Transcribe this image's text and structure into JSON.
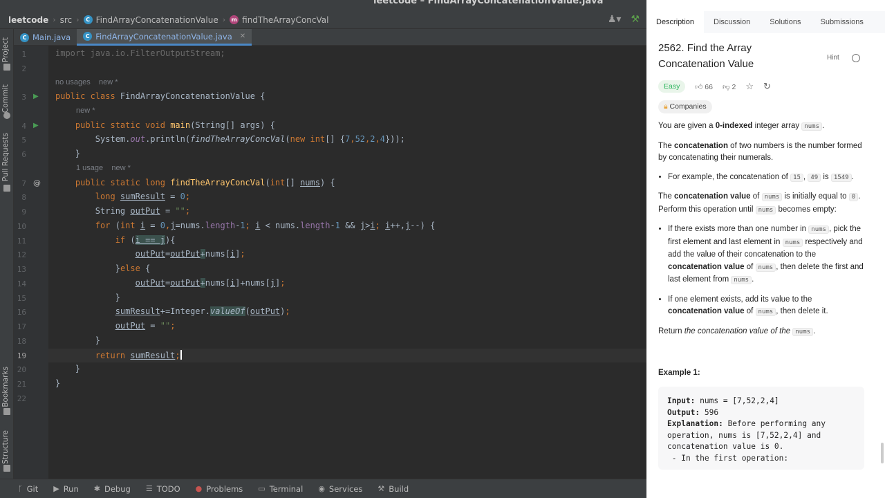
{
  "window_title": "leetcode – FindArrayConcatenationValue.java",
  "breadcrumb": {
    "project": "leetcode",
    "folder": "src",
    "class": "FindArrayConcatenationValue",
    "method": "findTheArrayConcVal"
  },
  "tabs": [
    {
      "label": "Main.java",
      "active": false
    },
    {
      "label": "FindArrayConcatenationValue.java",
      "active": true
    }
  ],
  "left_tool_windows": [
    "Project",
    "Commit",
    "Pull Requests",
    "Bookmarks",
    "Structure"
  ],
  "hints": {
    "no_usages": "no usages",
    "new": "new *",
    "one_usage": "1 usage"
  },
  "code": {
    "l1": "import java.io.FilterOutputStream;",
    "l3_a": "public class ",
    "l3_b": "FindArrayConcatenationValue {",
    "l4_a": "public static void ",
    "l4_b": "main",
    "l4_c": "(String[] args) {",
    "l5_a": "System.",
    "l5_b": "out",
    "l5_c": ".println(",
    "l5_d": "findTheArrayConcVal",
    "l5_e": "(",
    "l5_f": "new int",
    "l5_g": "[] {",
    "l5_h": "7",
    "l5_i": ",",
    "l5_j": "52",
    "l5_k": ",",
    "l5_l": "2",
    "l5_m": ",",
    "l5_n": "4",
    "l5_o": "}));",
    "l6": "}",
    "l7_a": "public static long ",
    "l7_b": "findTheArrayConcVal",
    "l7_c": "(",
    "l7_d": "int",
    "l7_e": "[] ",
    "l7_f": "nums",
    "l7_g": ") {",
    "l8_a": "long ",
    "l8_b": "sumResult",
    "l8_c": " = ",
    "l8_d": "0",
    "l8_e": ";",
    "l9_a": "String ",
    "l9_b": "outPut",
    "l9_c": " = ",
    "l9_d": "\"\"",
    "l9_e": ";",
    "l10_a": "for ",
    "l10_b": "(",
    "l10_c": "int ",
    "l10_d": "i",
    "l10_e": " = ",
    "l10_f": "0",
    "l10_g": ",",
    "l10_h": "j",
    "l10_i": "=nums.",
    "l10_j": "length",
    "l10_k": "-",
    "l10_l": "1",
    "l10_m": "; ",
    "l10_n": "i",
    "l10_o": " < nums.",
    "l10_p": "length",
    "l10_q": "-",
    "l10_r": "1",
    "l10_s": " && ",
    "l10_t": "j",
    "l10_u": ">",
    "l10_v": "i",
    "l10_w": "; ",
    "l10_x": "i",
    "l10_y": "++,",
    "l10_z": "j",
    "l10_zz": "--) {",
    "l11_a": "if ",
    "l11_b": "(",
    "l11_c": "i == j",
    "l11_d": "){",
    "l12_a": "outPut",
    "l12_b": "=",
    "l12_c": "outPut",
    "l12_d": "+",
    "l12_e": "nums[",
    "l12_f": "i",
    "l12_g": "]",
    "l12_h": ";",
    "l13_a": "}",
    "l13_b": "else ",
    "l13_c": "{",
    "l14_a": "outPut",
    "l14_b": "=",
    "l14_c": "outPut",
    "l14_d": "+",
    "l14_e": "nums[",
    "l14_f": "i",
    "l14_g": "]+nums[",
    "l14_h": "j",
    "l14_i": "]",
    "l14_j": ";",
    "l15": "}",
    "l16_a": "sumResult",
    "l16_b": "+=Integer.",
    "l16_c": "valueOf",
    "l16_d": "(",
    "l16_e": "outPut",
    "l16_f": ")",
    "l16_g": ";",
    "l17_a": "outPut",
    "l17_b": " = ",
    "l17_c": "\"\"",
    "l17_d": ";",
    "l18": "}",
    "l19_a": "return ",
    "l19_b": "sumResult",
    "l19_c": ";",
    "l20": "}",
    "l21": "}"
  },
  "line_numbers": [
    "1",
    "2",
    "3",
    "4",
    "5",
    "6",
    "7",
    "8",
    "9",
    "10",
    "11",
    "12",
    "13",
    "14",
    "15",
    "16",
    "17",
    "18",
    "19",
    "20",
    "21",
    "22"
  ],
  "current_line": 19,
  "status_bar": {
    "git": "Git",
    "run": "Run",
    "debug": "Debug",
    "todo": "TODO",
    "problems": "Problems",
    "terminal": "Terminal",
    "services": "Services",
    "build": "Build"
  },
  "leetcode": {
    "tabs": [
      "Description",
      "Discussion",
      "Solutions",
      "Submissions"
    ],
    "active_tab": "Description",
    "title": "2562. Find the Array Concatenation Value",
    "hint": "Hint",
    "difficulty": "Easy",
    "likes": "66",
    "dislikes": "2",
    "companies": "Companies",
    "p1_a": "You are given a ",
    "p1_b": "0-indexed",
    "p1_c": " integer array ",
    "p1_d": "nums",
    "p1_e": ".",
    "p2_a": "The ",
    "p2_b": "concatenation",
    "p2_c": " of two numbers is the number formed by concatenating their numerals.",
    "b1_a": "For example, the concatenation of ",
    "b1_b": "15",
    "b1_c": ", ",
    "b1_d": "49",
    "b1_e": " is ",
    "b1_f": "1549",
    "b1_g": ".",
    "p3_a": "The ",
    "p3_b": "concatenation value",
    "p3_c": " of ",
    "p3_d": "nums",
    "p3_e": " is initially equal to ",
    "p3_f": "0",
    "p3_g": ". Perform this operation until ",
    "p3_h": "nums",
    "p3_i": " becomes empty:",
    "b2_a": "If there exists more than one number in ",
    "b2_b": "nums",
    "b2_c": ", pick the first element and last element in ",
    "b2_d": "nums",
    "b2_e": " respectively and add the value of their concatenation to the ",
    "b2_f": "concatenation value",
    "b2_g": " of ",
    "b2_h": "nums",
    "b2_i": ", then delete the first and last element from ",
    "b2_j": "nums",
    "b2_k": ".",
    "b3_a": "If one element exists, add its value to the ",
    "b3_b": "concatenation value",
    "b3_c": " of ",
    "b3_d": "nums",
    "b3_e": ", then delete it.",
    "p4_a": "Return ",
    "p4_b": "the concatenation value of the ",
    "p4_c": "nums",
    "p4_d": ".",
    "example_title": "Example 1:",
    "ex_input_label": "Input:",
    "ex_input": " nums = [7,52,2,4]",
    "ex_output_label": "Output:",
    "ex_output": " 596",
    "ex_expl_label": "Explanation:",
    "ex_expl": " Before performing any operation, nums is [7,52,2,4] and concatenation value is 0.",
    "ex_more": " - In the first operation:"
  }
}
